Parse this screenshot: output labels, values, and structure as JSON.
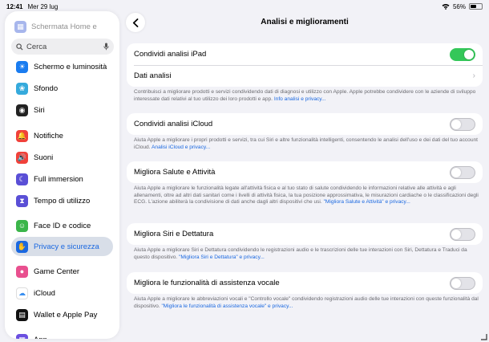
{
  "status_bar": {
    "time": "12:41",
    "date": "Mer 29 lug",
    "battery": "56%",
    "battery_level": 0.56
  },
  "sidebar": {
    "ghost_item": "Schermata Home e",
    "search_placeholder": "Cerca",
    "items": [
      {
        "label": "Schermo e luminosità",
        "icon": "sun-icon",
        "color": "#1a7cf0"
      },
      {
        "label": "Sfondo",
        "icon": "flower-icon",
        "color": "#35aadc"
      },
      {
        "label": "Siri",
        "icon": "siri-icon",
        "color": "#222222"
      },
      {
        "label": "Notifiche",
        "icon": "bell-icon",
        "color": "#f0413a"
      },
      {
        "label": "Suoni",
        "icon": "speaker-icon",
        "color": "#f0413a"
      },
      {
        "label": "Full immersion",
        "icon": "moon-icon",
        "color": "#5a4fd6"
      },
      {
        "label": "Tempo di utilizzo",
        "icon": "hourglass-icon",
        "color": "#5a4fd6"
      },
      {
        "label": "Face ID e codice",
        "icon": "face-id-icon",
        "color": "#3bb54a"
      },
      {
        "label": "Privacy e sicurezza",
        "icon": "hand-icon",
        "color": "#1a68e0",
        "selected": true
      },
      {
        "label": "Game Center",
        "icon": "game-center-icon",
        "color": "#e9508f"
      },
      {
        "label": "iCloud",
        "icon": "cloud-icon",
        "color": "#ffffff"
      },
      {
        "label": "Wallet e Apple Pay",
        "icon": "wallet-icon",
        "color": "#111111"
      },
      {
        "label": "App",
        "icon": "apps-icon",
        "color": "#6a4fe0"
      }
    ]
  },
  "main": {
    "title": "Analisi e miglioramenti",
    "groups": [
      {
        "rows": [
          {
            "label": "Condividi analisi iPad",
            "type": "toggle",
            "on": true
          },
          {
            "label": "Dati analisi",
            "type": "chevron"
          }
        ],
        "note": "Contribuisci a migliorare prodotti e servizi condividendo dati di diagnosi e utilizzo con Apple. Apple potrebbe condividere con le aziende di sviluppo interessate dati relativi al tuo utilizzo dei loro prodotti e app.",
        "note_link": "Info analisi e privacy..."
      },
      {
        "rows": [
          {
            "label": "Condividi analisi iCloud",
            "type": "toggle",
            "on": false
          }
        ],
        "note": "Aiuta Apple a migliorare i propri prodotti e servizi, tra cui Siri e altre funzionalità intelligenti, consentendo le analisi dell'uso e dei dati del tuo account iCloud.",
        "note_link": "Analisi iCloud e privacy..."
      },
      {
        "rows": [
          {
            "label": "Migliora Salute e Attività",
            "type": "toggle",
            "on": false
          }
        ],
        "note": "Aiuta Apple a migliorare le funzionalità legate all'attività fisica e al tuo stato di salute condividendo le informazioni relative alle attività e agli allenamenti, oltre ad altri dati sanitari come i livelli di attività fisica, la tua posizione approssimativa, le misurazioni cardiache o le classificazioni degli ECG. L'azione abiliterà la condivisione di dati anche dagli altri dispositivi che usi.",
        "note_link": "\"Migliora Salute e Attività\" e privacy..."
      },
      {
        "rows": [
          {
            "label": "Migliora Siri e Dettatura",
            "type": "toggle",
            "on": false
          }
        ],
        "note": "Aiuta Apple a migliorare Siri e Dettatura condividendo le registrazioni audio e le trascrizioni delle tue interazioni con Siri, Dettatura e Traduci da questo dispositivo.",
        "note_link": "\"Migliora Siri e Dettatura\" e privacy..."
      },
      {
        "rows": [
          {
            "label": "Migliora le funzionalità di assistenza vocale",
            "type": "toggle",
            "on": false
          }
        ],
        "note": "Aiuta Apple a migliorare le abbreviazioni vocali e \"Controllo vocale\" condividendo registrazioni audio delle tue interazioni con queste funzionalità dal dispositivo.",
        "note_link": "\"Migliora le funzionalità di assistenza vocale\" e privacy..."
      }
    ]
  }
}
